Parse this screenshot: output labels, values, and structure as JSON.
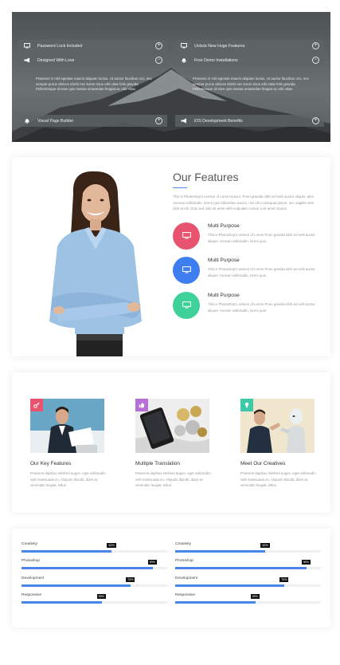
{
  "accordion": {
    "left": {
      "items": [
        {
          "label": "Password Lock Included",
          "icon": "monitor-icon",
          "toggle": "+"
        },
        {
          "label": "Designed With Love",
          "icon": "megaphone-icon",
          "toggle": "−"
        }
      ],
      "body": "Praesent in nisl egestas mauris aliquam luctus. Ut auctor faucibus orci, nec semper purus ultrices idorbi nec lorem risus orbi vitae felis gravida Pellentesque id erae quis massa ornareidae feugiat ac orbi vitae.",
      "bottom": {
        "label": "Visual Page Builder",
        "icon": "bell-icon",
        "toggle": "+"
      }
    },
    "right": {
      "items": [
        {
          "label": "Unlock New Huge Features",
          "icon": "monitor-icon",
          "toggle": "+"
        },
        {
          "label": "Free Demo Installations",
          "icon": "bell-icon",
          "toggle": "−"
        }
      ],
      "body": "Praesent in nisl egestas mauris aliquam luctus. Ut auctor faucibus orci, nec semper purus ultrices idorbi nec lorem risus orbi vitae felis gravida Pellentesque id erae quis massa ornareidae feugiat ac orbi vitae.",
      "bottom": {
        "label": "iOS Development Benefits",
        "icon": "megaphone-icon",
        "toggle": "+"
      }
    }
  },
  "features": {
    "title": "Our Features",
    "intro": "This is Photoshop's version of Lorem Ipsum. Proin gravida nibh vel velit auctor aliquet. ales Aenean sollicitudin, lorem quis bibendum auctor, nisi elit consequat ipsum; nec sagittis sem nibh id elit. Duis sed odio sit amet nibh vulputate cursus a sit amet mauris.",
    "items": [
      {
        "name": "Multi Purpose",
        "desc": "This is Photoshop's version of Lorem Proin gravida nibh vel velit auctor aliquet. Aenean sollicitudin, lorem quis.",
        "color": "#e8546f"
      },
      {
        "name": "Multi Purpose",
        "desc": "This is Photoshop's version of Lorem Proin gravida nibh vel velit auctor aliquet. Aenean sollicitudin, lorem quis.",
        "color": "#3f7ef0"
      },
      {
        "name": "Multi Purpose",
        "desc": "This is Photoshop's version of Lorem Proin gravida nibh vel velit auctor aliquet. Aenean sollicitudin, lorem quis.",
        "color": "#3ed29a"
      }
    ]
  },
  "services": [
    {
      "name": "Our Key Features",
      "desc": "Praesent dapibus eleifend augue, eget sollicitudin velit malesuada eu. Aliquam blandit, diam ac venenatis feugiat, tellus.",
      "badge_color": "#e8546f",
      "badge_icon": "key-icon"
    },
    {
      "name": "Multiple Translation",
      "desc": "Praesent dapibus eleifend augue, eget sollicitudin velit malesuada eu. Aliquam blandit, diam ac venenatis feugiat, tellus.",
      "badge_color": "#b56fd6",
      "badge_icon": "thumbs-up-icon"
    },
    {
      "name": "Meet Our Creatives",
      "desc": "Praesent dapibus eleifend augue, eget sollicitudin velit malesuada eu. Aliquam blandit, diam ac venenatis feugiat, tellus.",
      "badge_color": "#3ec9a7",
      "badge_icon": "lightbulb-icon"
    }
  ],
  "skills": {
    "left": [
      {
        "label": "Creativity",
        "percent": 62,
        "text": "62%"
      },
      {
        "label": "Photoshop",
        "percent": 90,
        "text": "90%"
      },
      {
        "label": "Development",
        "percent": 75,
        "text": "75%"
      },
      {
        "label": "Responsive",
        "percent": 55,
        "text": "55%"
      }
    ],
    "right": [
      {
        "label": "Creativity",
        "percent": 62,
        "text": "62%"
      },
      {
        "label": "Photoshop",
        "percent": 90,
        "text": "90%"
      },
      {
        "label": "Development",
        "percent": 75,
        "text": "75%"
      },
      {
        "label": "Responsive",
        "percent": 55,
        "text": "55%"
      }
    ],
    "bar_color": "#4a86e8"
  }
}
